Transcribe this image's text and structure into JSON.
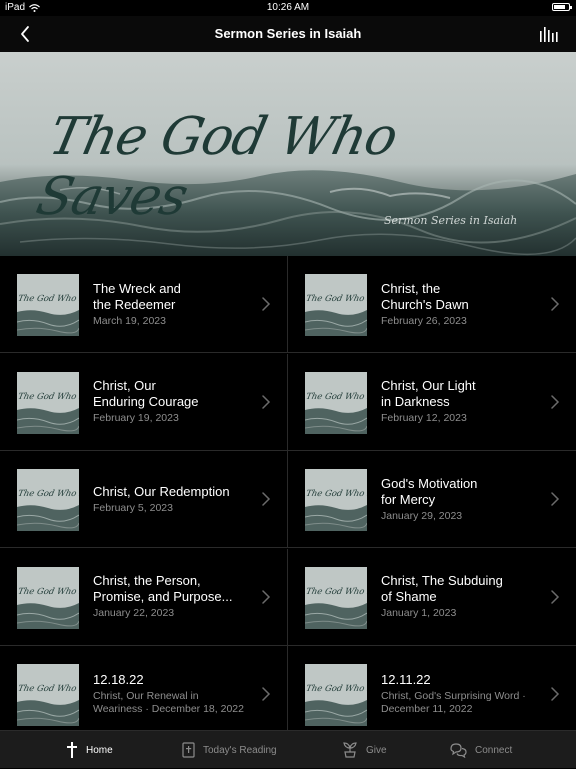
{
  "status_bar": {
    "device": "iPad",
    "time": "10:26 AM"
  },
  "nav": {
    "title": "Sermon Series in Isaiah"
  },
  "hero": {
    "script_title": "The God Who Saves",
    "subtitle": "Sermon Series in Isaiah"
  },
  "thumb_text": "The God Who Saves",
  "sermons": [
    {
      "title": "The Wreck and\nthe Redeemer",
      "subtitle": "March 19, 2023"
    },
    {
      "title": "Christ, the\nChurch's Dawn",
      "subtitle": "February 26, 2023"
    },
    {
      "title": "Christ, Our\nEnduring Courage",
      "subtitle": "February 19, 2023"
    },
    {
      "title": "Christ, Our Light\nin Darkness",
      "subtitle": "February 12, 2023"
    },
    {
      "title": "Christ, Our Redemption",
      "subtitle": "February 5, 2023"
    },
    {
      "title": "God's Motivation\nfor Mercy",
      "subtitle": "January 29, 2023"
    },
    {
      "title": "Christ, the Person,\nPromise, and Purpose...",
      "subtitle": "January 22, 2023"
    },
    {
      "title": "Christ, The Subduing\nof Shame",
      "subtitle": "January 1, 2023"
    },
    {
      "title": "12.18.22",
      "subtitle": "Christ, Our Renewal in\nWeariness · December 18, 2022"
    },
    {
      "title": "12.11.22",
      "subtitle": "Christ, God's Surprising Word ·\nDecember 11, 2022"
    }
  ],
  "tabs": [
    {
      "label": "Home",
      "icon": "cross-icon",
      "active": true
    },
    {
      "label": "Today's Reading",
      "icon": "bible-icon",
      "active": false
    },
    {
      "label": "Give",
      "icon": "plant-icon",
      "active": false
    },
    {
      "label": "Connect",
      "icon": "chat-bubbles-icon",
      "active": false
    }
  ]
}
